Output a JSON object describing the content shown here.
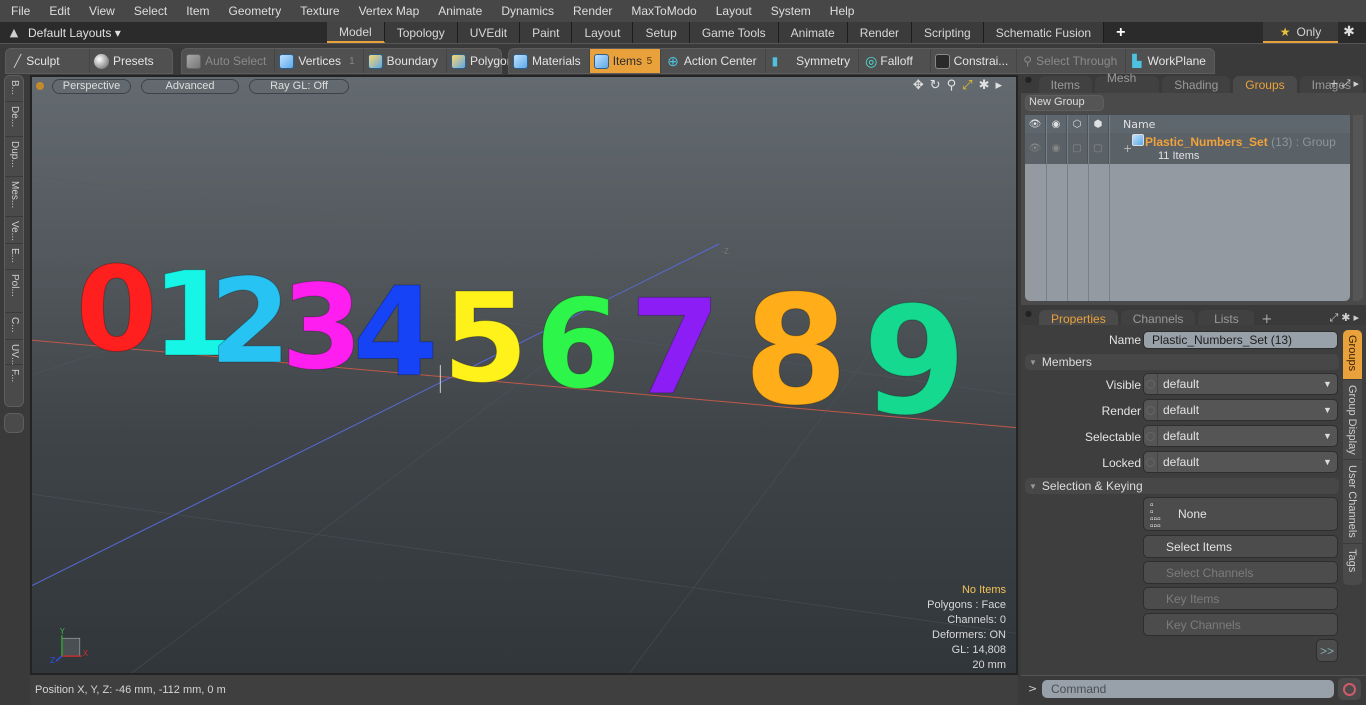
{
  "menu": [
    "File",
    "Edit",
    "View",
    "Select",
    "Item",
    "Geometry",
    "Texture",
    "Vertex Map",
    "Animate",
    "Dynamics",
    "Render",
    "MaxToModo",
    "Layout",
    "System",
    "Help"
  ],
  "layoutbar": {
    "layouts_label": "Default Layouts ▾",
    "tabs": [
      "Model",
      "Topology",
      "UVEdit",
      "Paint",
      "Layout",
      "Setup",
      "Game Tools",
      "Animate",
      "Render",
      "Scripting",
      "Schematic Fusion"
    ],
    "active_tab": "Model",
    "add_tab": "+",
    "only_label": "Only"
  },
  "toolbar": {
    "sculpt": "Sculpt",
    "presets": "Presets",
    "auto_select": "Auto Select",
    "vertices": "Vertices",
    "vertices_count": "1",
    "boundary": "Boundary",
    "polygons": "Polygons",
    "materials": "Materials",
    "items": "Items",
    "items_count": "5",
    "action_center": "Action Center",
    "symmetry": "Symmetry",
    "falloff": "Falloff",
    "constraints": "Constrai...",
    "select_through": "Select Through",
    "workplane": "WorkPlane"
  },
  "left_tabs": [
    "B...",
    "De...",
    "Dup...",
    "Mes...",
    "Ve...",
    "E...",
    "Pol...",
    "C...",
    "UV...",
    "F..."
  ],
  "viewport": {
    "view_mode": "Perspective",
    "shading": "Advanced",
    "raygl": "Ray GL: Off",
    "axis_label": "-Z",
    "digits": [
      {
        "char": "0",
        "color": "#ff1f1f"
      },
      {
        "char": "1",
        "color": "#17f5e6"
      },
      {
        "char": "2",
        "color": "#27c3f2"
      },
      {
        "char": "3",
        "color": "#ff1ef0"
      },
      {
        "char": "4",
        "color": "#1543f5"
      },
      {
        "char": "5",
        "color": "#fff21a"
      },
      {
        "char": "6",
        "color": "#2ef54a"
      },
      {
        "char": "7",
        "color": "#8c1ef5"
      },
      {
        "char": "8",
        "color": "#ffae1a"
      },
      {
        "char": "9",
        "color": "#14d98f"
      }
    ],
    "stats": {
      "selection": "No Items",
      "polygons": "Polygons : Face",
      "channels": "Channels: 0",
      "deformers": "Deformers: ON",
      "gl": "GL: 14,808",
      "grid": "20 mm"
    },
    "gizmo": {
      "y": "Y",
      "x": "X",
      "z": "Z"
    }
  },
  "statusbar": {
    "position": "Position X, Y, Z:   -46 mm, -112 mm, 0 m"
  },
  "top_panel": {
    "tabs": [
      "Items",
      "Mesh ...",
      "Shading",
      "Groups",
      "Images"
    ],
    "active_tab": "Groups",
    "new_group": "New Group",
    "column_name": "Name",
    "group": {
      "name": "Plastic_Numbers_Set",
      "suffix": " (13) : Group",
      "items": "11 Items"
    }
  },
  "bottom_panel": {
    "tabs": [
      "Properties",
      "Channels",
      "Lists"
    ],
    "active_tab": "Properties",
    "name_label": "Name",
    "name_value": "Plastic_Numbers_Set (13)",
    "members_section": "Members",
    "fields": [
      {
        "label": "Visible",
        "value": "default"
      },
      {
        "label": "Render",
        "value": "default"
      },
      {
        "label": "Selectable",
        "value": "default"
      },
      {
        "label": "Locked",
        "value": "default"
      }
    ],
    "selection_section": "Selection & Keying",
    "none_label": "None",
    "buttons": [
      {
        "label": "Select Items",
        "enabled": true
      },
      {
        "label": "Select Channels",
        "enabled": false
      },
      {
        "label": "Key Items",
        "enabled": false
      },
      {
        "label": "Key Channels",
        "enabled": false
      }
    ],
    "more": ">>",
    "side_tabs": [
      "Groups",
      "Group Display",
      "User Channels",
      "Tags"
    ],
    "active_side_tab": "Groups"
  },
  "command": {
    "prompt": ">",
    "placeholder": "Command"
  }
}
